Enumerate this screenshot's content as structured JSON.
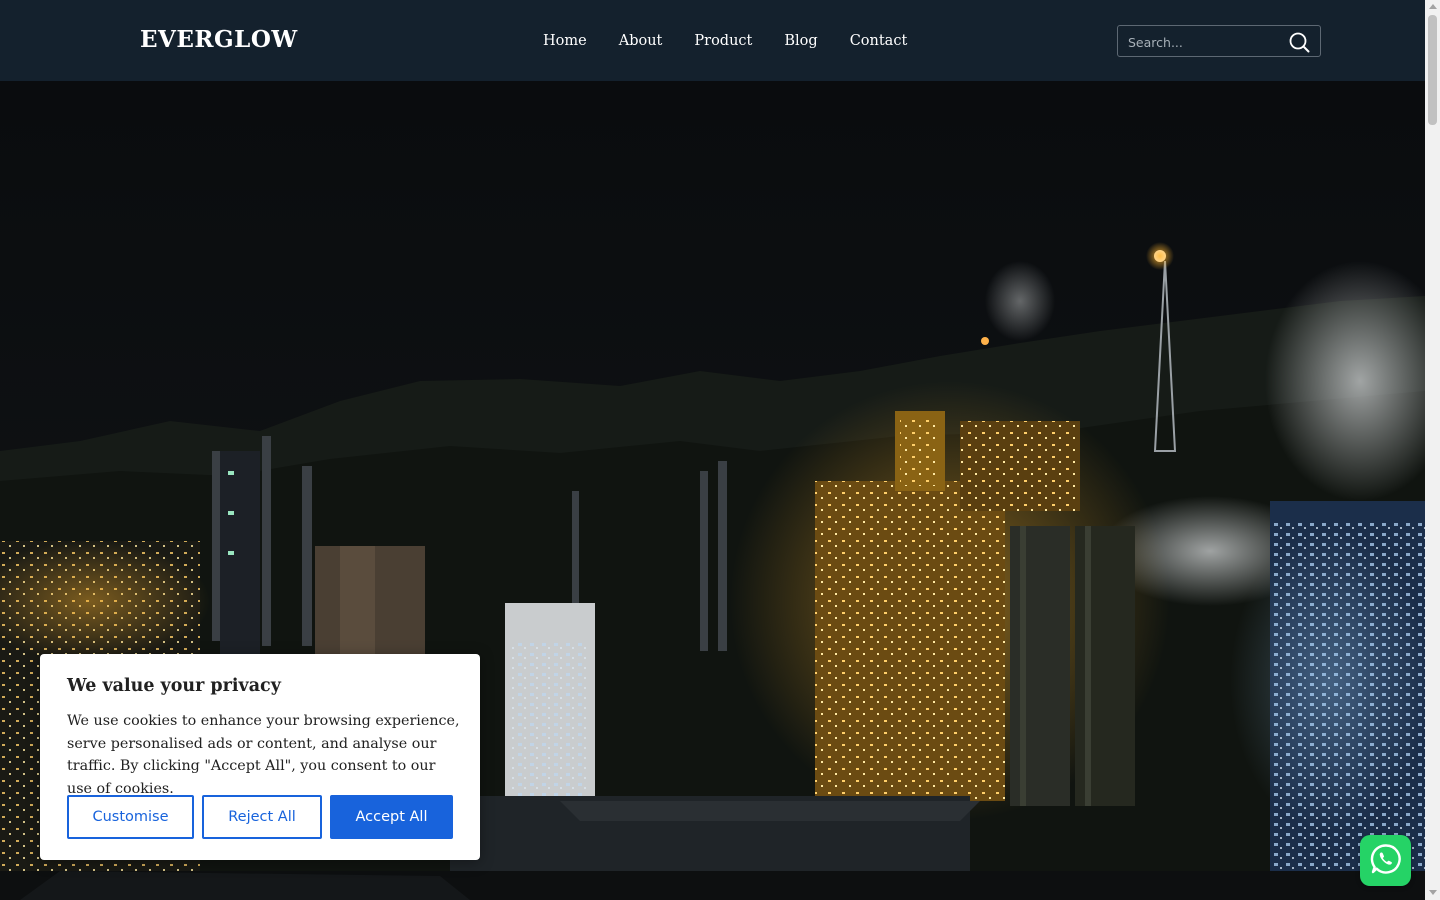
{
  "brand": {
    "logo": "EVERGLOW"
  },
  "nav": {
    "items": [
      {
        "label": "Home"
      },
      {
        "label": "About"
      },
      {
        "label": "Product"
      },
      {
        "label": "Blog"
      },
      {
        "label": "Contact"
      }
    ]
  },
  "search": {
    "placeholder": "Search...",
    "value": "",
    "icon": "search-icon"
  },
  "hero": {
    "image": "night-industrial-plant-photo"
  },
  "cookie": {
    "title": "We value your privacy",
    "body": "We use cookies to enhance your browsing experience, serve personalised ads or content, and analyse our traffic. By clicking \"Accept All\", you consent to our use of cookies.",
    "customise_label": "Customise",
    "reject_label": "Reject All",
    "accept_label": "Accept All"
  },
  "whatsapp": {
    "icon": "whatsapp-icon"
  },
  "colors": {
    "header_bg": "#14212d",
    "accent": "#1863dc",
    "whatsapp": "#25d366"
  }
}
